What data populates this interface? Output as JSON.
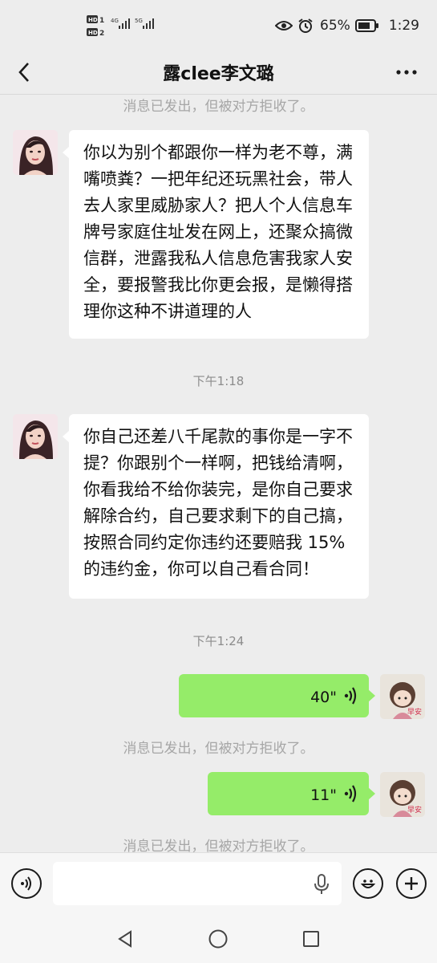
{
  "status_bar": {
    "hd1": "HD 1",
    "hd2": "HD 2",
    "net1": "4G",
    "net2": "5G",
    "battery_pct": "65%",
    "time": "1:29"
  },
  "nav": {
    "title": "露clee李文璐"
  },
  "messages": {
    "sys_top": "消息已发出，但被对方拒收了。",
    "msg1": "你以为别个都跟你一样为老不尊，满嘴喷粪？一把年纪还玩黑社会，带人去人家里威胁家人？把人个人信息车牌号家庭住址发在网上，还聚众搞微信群，泄露我私人信息危害我家人安全，要报警我比你更会报，是懒得搭理你这种不讲道理的人",
    "time1": "下午1:18",
    "msg2": "你自己还差八千尾款的事你是一字不提？你跟别个一样啊，把钱给清啊，你看我给不给你装完，是你自己要求解除合约，自己要求剩下的自己搞，按照合同约定你违约还要赔我 15% 的违约金，你可以自己看合同！",
    "time2": "下午1:24",
    "voice1": "40\"",
    "sys_mid": "消息已发出，但被对方拒收了。",
    "voice2": "11\"",
    "sys_bottom": "消息已发出，但被对方拒收了。"
  },
  "avatars": {
    "self_text": "早安"
  },
  "colors": {
    "background": "#ededed",
    "outgoing_bubble": "#95ec69",
    "incoming_bubble": "#ffffff",
    "system_text": "#a6a6a6"
  },
  "icons": [
    "back-arrow-icon",
    "more-icon",
    "voice-mode-icon",
    "mic-icon",
    "emoji-icon",
    "plus-icon",
    "back-triangle-icon",
    "home-circle-icon",
    "recents-square-icon",
    "voice-wave-icon",
    "eye-icon",
    "alarm-icon",
    "battery-icon"
  ]
}
